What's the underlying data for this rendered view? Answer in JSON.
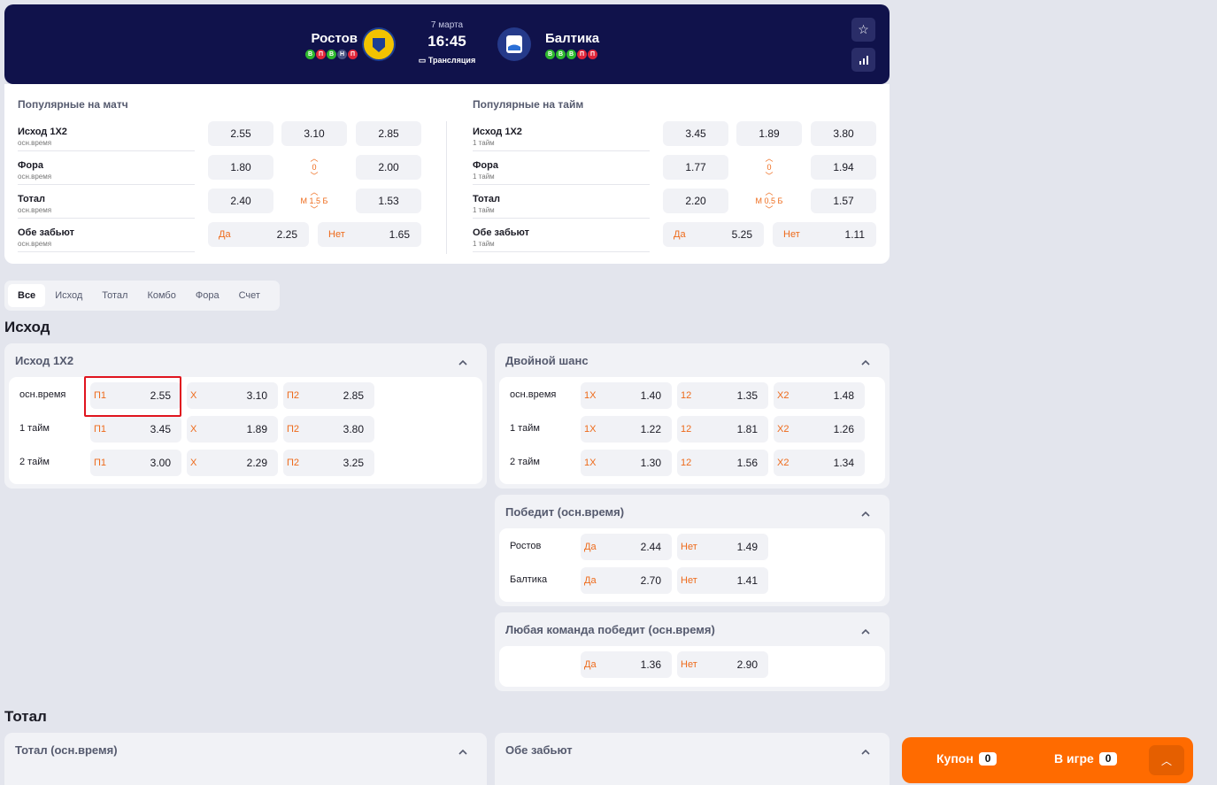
{
  "header": {
    "home": "Ростов",
    "home_form": [
      "В",
      "П",
      "В",
      "Н",
      "П"
    ],
    "away": "Балтика",
    "away_form": [
      "В",
      "В",
      "В",
      "П",
      "П"
    ],
    "date": "7 марта",
    "time": "16:45",
    "stream": "Трансляция"
  },
  "popular": {
    "match": {
      "title": "Популярные на матч",
      "sub": "осн.время",
      "rows": [
        {
          "name": "Исход 1Х2",
          "v": [
            "2.55",
            "3.10",
            "2.85"
          ]
        },
        {
          "name": "Фора",
          "v": [
            "1.80",
            "0",
            "2.00"
          ]
        },
        {
          "name": "Тотал",
          "v": [
            "2.40",
            "М 1.5 Б",
            "1.53"
          ]
        },
        {
          "name": "Обе забьют",
          "yes": "Да",
          "yv": "2.25",
          "no": "Нет",
          "nv": "1.65"
        }
      ]
    },
    "half": {
      "title": "Популярные на тайм",
      "sub": "1 тайм",
      "rows": [
        {
          "name": "Исход 1Х2",
          "v": [
            "3.45",
            "1.89",
            "3.80"
          ]
        },
        {
          "name": "Фора",
          "v": [
            "1.77",
            "0",
            "1.94"
          ]
        },
        {
          "name": "Тотал",
          "v": [
            "2.20",
            "М 0.5 Б",
            "1.57"
          ]
        },
        {
          "name": "Обе забьют",
          "yes": "Да",
          "yv": "5.25",
          "no": "Нет",
          "nv": "1.11"
        }
      ]
    }
  },
  "tabs": [
    "Все",
    "Исход",
    "Тотал",
    "Комбо",
    "Фора",
    "Счет"
  ],
  "sections": {
    "outcome": "Исход",
    "total": "Тотал"
  },
  "outcome1x2": {
    "title": "Исход 1X2",
    "rows": [
      {
        "label": "осн.время",
        "c": [
          [
            "П1",
            "2.55"
          ],
          [
            "Х",
            "3.10"
          ],
          [
            "П2",
            "2.85"
          ]
        ]
      },
      {
        "label": "1 тайм",
        "c": [
          [
            "П1",
            "3.45"
          ],
          [
            "Х",
            "1.89"
          ],
          [
            "П2",
            "3.80"
          ]
        ]
      },
      {
        "label": "2 тайм",
        "c": [
          [
            "П1",
            "3.00"
          ],
          [
            "Х",
            "2.29"
          ],
          [
            "П2",
            "3.25"
          ]
        ]
      }
    ]
  },
  "double": {
    "title": "Двойной шанс",
    "rows": [
      {
        "label": "осн.время",
        "c": [
          [
            "1Х",
            "1.40"
          ],
          [
            "12",
            "1.35"
          ],
          [
            "Х2",
            "1.48"
          ]
        ]
      },
      {
        "label": "1 тайм",
        "c": [
          [
            "1Х",
            "1.22"
          ],
          [
            "12",
            "1.81"
          ],
          [
            "Х2",
            "1.26"
          ]
        ]
      },
      {
        "label": "2 тайм",
        "c": [
          [
            "1Х",
            "1.30"
          ],
          [
            "12",
            "1.56"
          ],
          [
            "Х2",
            "1.34"
          ]
        ]
      }
    ]
  },
  "win": {
    "title": "Победит (осн.время)",
    "rows": [
      {
        "label": "Ростов",
        "c": [
          [
            "Да",
            "2.44"
          ],
          [
            "Нет",
            "1.49"
          ]
        ]
      },
      {
        "label": "Балтика",
        "c": [
          [
            "Да",
            "2.70"
          ],
          [
            "Нет",
            "1.41"
          ]
        ]
      }
    ]
  },
  "anywin": {
    "title": "Любая команда победит (осн.время)",
    "rows": [
      {
        "label": "",
        "c": [
          [
            "Да",
            "1.36"
          ],
          [
            "Нет",
            "2.90"
          ]
        ]
      }
    ]
  },
  "total_card": {
    "title": "Тотал (осн.время)"
  },
  "both_card": {
    "title": "Обе забьют"
  },
  "coupon": {
    "label": "Купон",
    "count": "0",
    "ingame": "В игре",
    "ingame_count": "0"
  }
}
